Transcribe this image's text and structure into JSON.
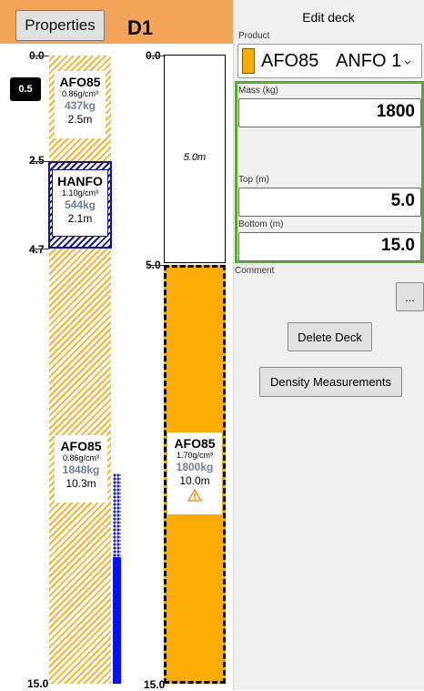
{
  "header": {
    "properties_label": "Properties",
    "hole_title": "D1"
  },
  "left_column": {
    "depth_labels": [
      "0.0",
      "2.5",
      "4.7",
      "15.0"
    ],
    "water_badge": "0.5",
    "decks": [
      {
        "name": "AFO85",
        "density": "0.86g/cm³",
        "mass": "437kg",
        "length": "2.5m"
      },
      {
        "name": "HANFO",
        "density": "1.10g/cm³",
        "mass": "544kg",
        "length": "2.1m"
      },
      {
        "name": "AFO85",
        "density": "0.86g/cm³",
        "mass": "1848kg",
        "length": "10.3m"
      }
    ]
  },
  "right_column": {
    "depth_labels": [
      "0.0",
      "5.0",
      "15.0"
    ],
    "stemming_length": "5.0m",
    "deck": {
      "name": "AFO85",
      "density": "1.70g/cm³",
      "mass": "1800kg",
      "length": "10.0m",
      "warning_icon": "warning-triangle-icon"
    }
  },
  "edit_panel": {
    "title": "Edit deck",
    "product_label": "Product",
    "product_name": "AFO85",
    "product_type": "ANFO 1",
    "product_color": "#fbab05",
    "mass_label": "Mass (kg)",
    "mass_value": "1800",
    "top_label": "Top (m)",
    "top_value": "5.0",
    "bottom_label": "Bottom (m)",
    "bottom_value": "15.0",
    "comment_label": "Comment",
    "more_button": "...",
    "delete_button": "Delete Deck",
    "density_button": "Density Measurements",
    "highlight_color": "#58a83c"
  }
}
